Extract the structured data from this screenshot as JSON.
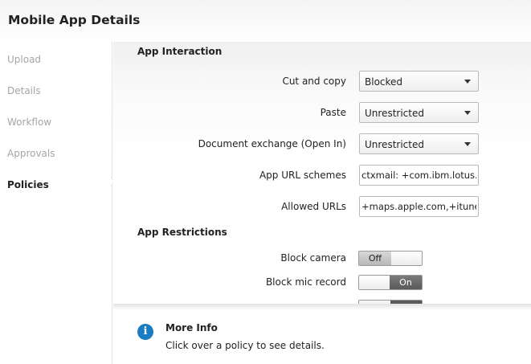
{
  "header": {
    "title": "Mobile App Details"
  },
  "sidebar": {
    "items": [
      {
        "label": "Upload",
        "active": false
      },
      {
        "label": "Details",
        "active": false
      },
      {
        "label": "Workflow",
        "active": false
      },
      {
        "label": "Approvals",
        "active": false
      },
      {
        "label": "Policies",
        "active": true
      }
    ]
  },
  "app_interaction": {
    "title": "App Interaction",
    "cut_copy": {
      "label": "Cut and copy",
      "value": "Blocked"
    },
    "paste": {
      "label": "Paste",
      "value": "Unrestricted"
    },
    "doc_exchange": {
      "label": "Document exchange (Open In)",
      "value": "Unrestricted"
    },
    "url_schemes": {
      "label": "App URL schemes",
      "value": "ctxmail: +com.ibm.lotus.tr"
    },
    "allowed_urls": {
      "label": "Allowed URLs",
      "value": "+maps.apple.com,+itunes.a"
    }
  },
  "app_restrictions": {
    "title": "App Restrictions",
    "block_camera": {
      "label": "Block camera",
      "state": "Off"
    },
    "block_mic": {
      "label": "Block mic record",
      "state": "On"
    }
  },
  "more_info": {
    "icon": "info-icon",
    "title": "More Info",
    "text": "Click over a policy to see details."
  },
  "colors": {
    "info_icon": "#1b7cc1",
    "toggle_on": "#5a5a5a"
  }
}
